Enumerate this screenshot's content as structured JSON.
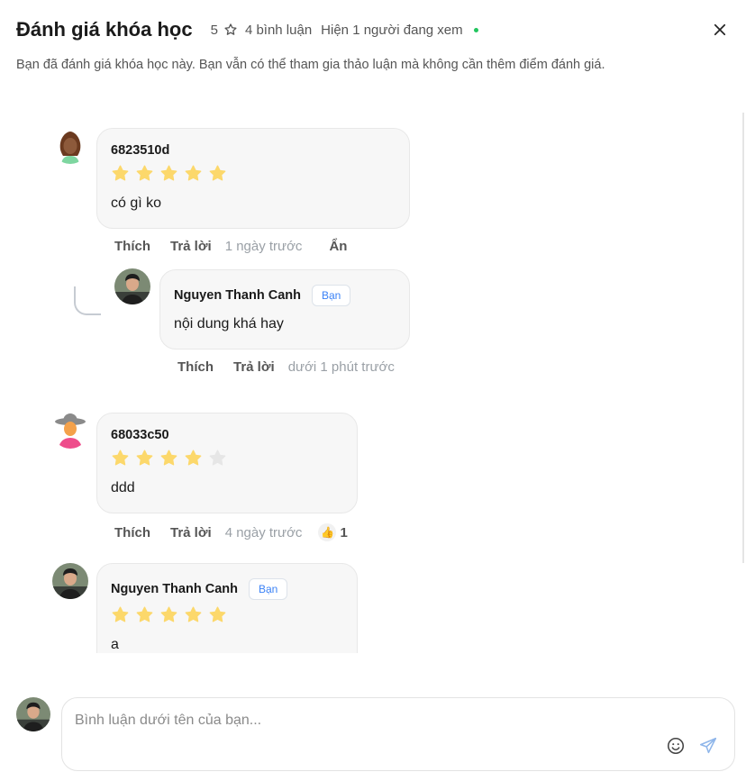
{
  "header": {
    "title": "Đánh giá khóa học",
    "rating": "5",
    "comment_count": "4 bình luận",
    "viewers": "Hiện 1 người đang xem"
  },
  "subtitle": "Bạn đã đánh giá khóa học này. Bạn vẫn có thể tham gia thảo luận mà không cần thêm điểm đánh giá.",
  "comments": [
    {
      "author": "6823510d",
      "stars": 5,
      "text": "có gì ko",
      "like": "Thích",
      "reply": "Trả lời",
      "time": "1 ngày trước",
      "hide": "Ẩn",
      "replies": [
        {
          "author": "Nguyen Thanh Canh",
          "badge": "Bạn",
          "text": "nội dung khá hay",
          "like": "Thích",
          "reply": "Trả lời",
          "time": "dưới 1 phút trước"
        }
      ]
    },
    {
      "author": "68033c50",
      "stars": 4,
      "text": "ddd",
      "like": "Thích",
      "reply": "Trả lời",
      "time": "4 ngày trước",
      "reaction_icon": "thumbs-up-icon",
      "reaction_count": "1"
    },
    {
      "author": "Nguyen Thanh Canh",
      "badge": "Bạn",
      "stars": 5,
      "text": "a"
    }
  ],
  "composer": {
    "placeholder": "Bình luận dưới tên của bạn..."
  },
  "colors": {
    "star_filled": "#fcd86b",
    "star_empty": "#e6e6e6",
    "badge_text": "#3b82f6",
    "online_dot": "#22c55e"
  }
}
